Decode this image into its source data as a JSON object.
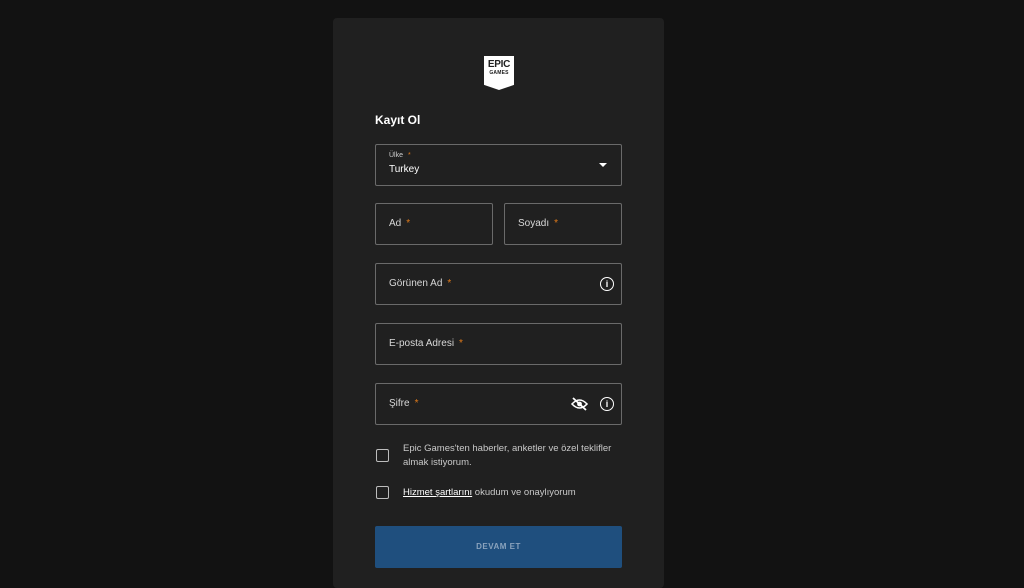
{
  "logo": {
    "line1": "EPIC",
    "line2": "GAMES"
  },
  "form": {
    "title": "Kayıt Ol",
    "country": {
      "label": "Ülke",
      "value": "Turkey"
    },
    "first_name": {
      "label": "Ad"
    },
    "last_name": {
      "label": "Soyadı"
    },
    "display_name": {
      "label": "Görünen Ad"
    },
    "email": {
      "label": "E-posta Adresi"
    },
    "password": {
      "label": "Şifre"
    },
    "required_mark": "*",
    "newsletter_checkbox": {
      "text": "Epic Games'ten haberler, anketler ve özel teklifler almak istiyorum."
    },
    "terms_checkbox": {
      "link": "Hizmet şartlarını",
      "text": " okudum ve onaylıyorum"
    },
    "submit_label": "DEVAM ET"
  },
  "colors": {
    "background": "#121212",
    "card": "#202020",
    "required": "#e07a1a",
    "button": "#1f4f7e"
  },
  "icons": {
    "dropdown": "chevron-down-icon",
    "info": "info-icon",
    "password_visibility": "eye-off-icon"
  }
}
